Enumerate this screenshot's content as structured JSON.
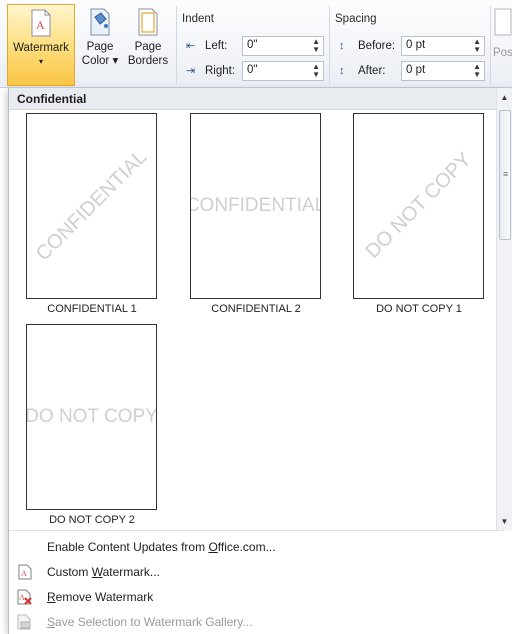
{
  "ribbon": {
    "watermark_label": "Watermark",
    "watermark_arrow": "▾",
    "page_color_label_1": "Page",
    "page_color_label_2": "Color ▾",
    "page_borders_label_1": "Page",
    "page_borders_label_2": "Borders",
    "indent": {
      "title": "Indent",
      "left_label": "Left:",
      "left_value": "0\"",
      "right_label": "Right:",
      "right_value": "0\""
    },
    "spacing": {
      "title": "Spacing",
      "before_label": "Before:",
      "before_value": "0 pt",
      "after_label": "After:",
      "after_value": "0 pt"
    },
    "position_partial": "Pos"
  },
  "gallery": {
    "category": "Confidential",
    "items": [
      {
        "label": "CONFIDENTIAL 1",
        "watermark": "CONFIDENTIAL",
        "style": "diagonal"
      },
      {
        "label": "CONFIDENTIAL 2",
        "watermark": "CONFIDENTIAL",
        "style": "horizontal"
      },
      {
        "label": "DO NOT COPY 1",
        "watermark": "DO NOT COPY",
        "style": "diagonal"
      },
      {
        "label": "DO NOT COPY 2",
        "watermark": "DO NOT COPY",
        "style": "horizontal"
      }
    ]
  },
  "menu": {
    "enable_updates": {
      "pre": "Enable Content Updates from ",
      "accel": "O",
      "post": "ffice.com..."
    },
    "custom": {
      "pre": "Custom ",
      "accel": "W",
      "post": "atermark..."
    },
    "remove": {
      "pre": "",
      "accel": "R",
      "post": "emove Watermark"
    },
    "save": {
      "pre": "",
      "accel": "S",
      "post": "ave Selection to Watermark Gallery..."
    }
  },
  "colors": {
    "accent": "#f9c545",
    "watermark_text": "#cfcfcf",
    "disabled_text": "#9a9a9a"
  }
}
